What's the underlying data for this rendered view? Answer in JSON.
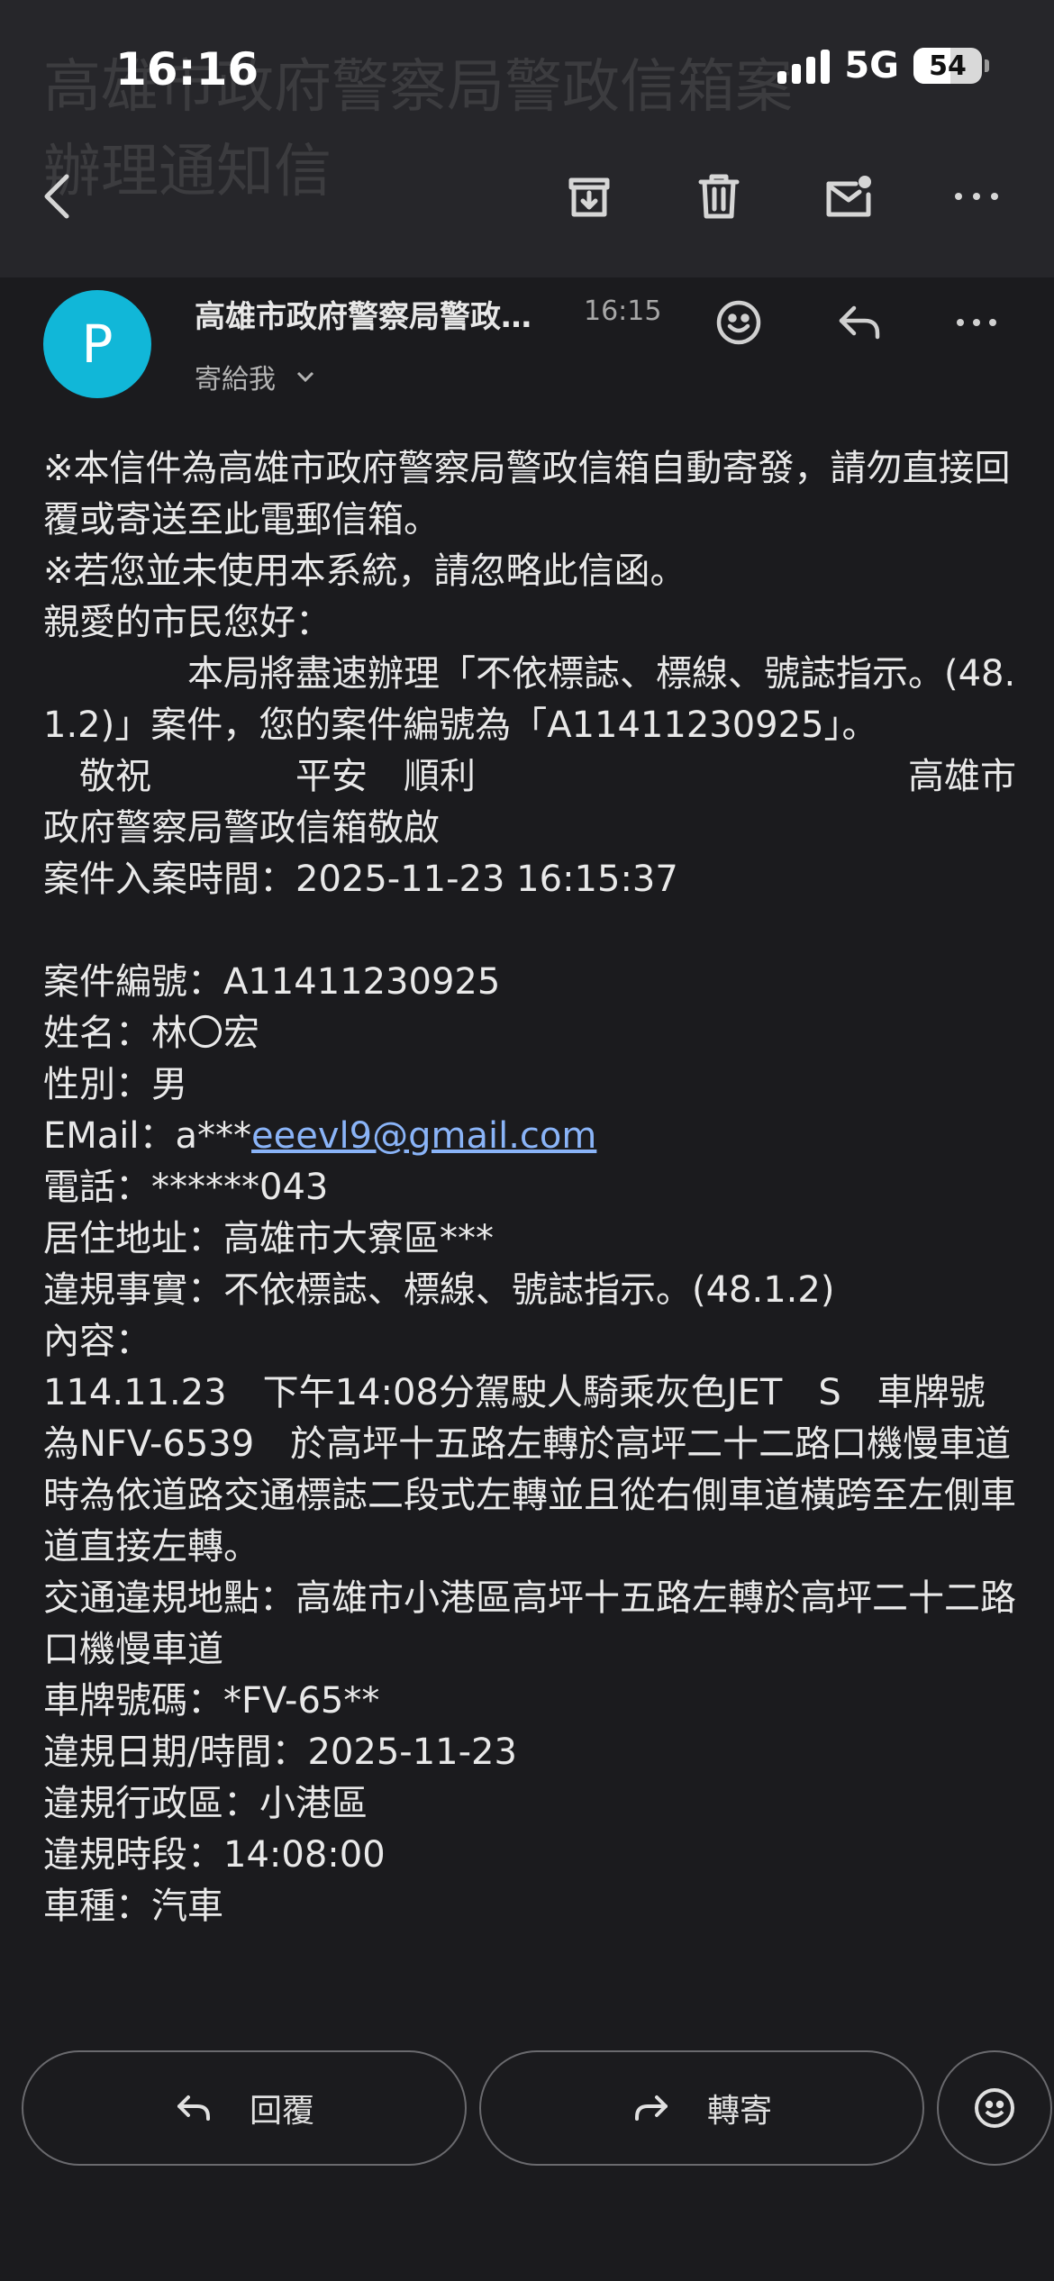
{
  "status_bar": {
    "time": "16:16",
    "network": "5G",
    "battery": "54",
    "battery_level": 0.54
  },
  "subject_partial": {
    "line1": "高雄市政府警察局警政信箱案",
    "line2": "辦理通知信"
  },
  "toolbar": {
    "back_icon": "arrow-left-icon",
    "archive_icon": "archive-icon",
    "delete_icon": "trash-icon",
    "mark_unread_icon": "mail-unread-icon",
    "more_icon": "more-horizontal-icon"
  },
  "message": {
    "avatar_letter": "P",
    "avatar_color": "#11b7d8",
    "sender": "高雄市政府警察局警政信箱",
    "time": "16:15",
    "recipient": "寄給我",
    "body_lines": [
      "※本信件為高雄市政府警察局警政信箱自動寄發，請勿直接回覆或寄送至此電郵信箱。",
      "※若您並未使用本系統，請忽略此信函。",
      "親愛的市民您好：",
      "　　　　本局將盡速辦理「不依標誌、標線、號誌指示。(48.1.2)」案件，您的案件編號為「A11411230925」。",
      "　敬祝　　　　平安　順利　　　　　　　　　　　　高雄市政府警察局警政信箱敬啟",
      "案件入案時間：2025-11-23 16:15:37",
      "",
      "案件編號：A11411230925",
      "姓名：林〇宏",
      "性別：男"
    ],
    "email_label": "EMail：a***",
    "email_link": "eeevl9@gmail.com",
    "body_lines_after": [
      "電話：******043",
      "居住地址：高雄市大寮區***",
      "違規事實：不依標誌、標線、號誌指示。(48.1.2)",
      "內容：",
      "114.11.23　下午14:08分駕駛人騎乘灰色JET　S　車牌號為NFV-6539　於高坪十五路左轉於高坪二十二路口機慢車道時為依道路交通標誌二段式左轉並且從右側車道橫跨至左側車道直接左轉。",
      "交通違規地點：高雄市小港區高坪十五路左轉於高坪二十二路口機慢車道",
      "車牌號碼：*FV-65**",
      "違規日期/時間：2025-11-23",
      "違規行政區：小港區",
      "違規時段：14:08:00",
      "車種：汽車"
    ]
  },
  "actions": {
    "reply": "回覆",
    "forward": "轉寄"
  }
}
